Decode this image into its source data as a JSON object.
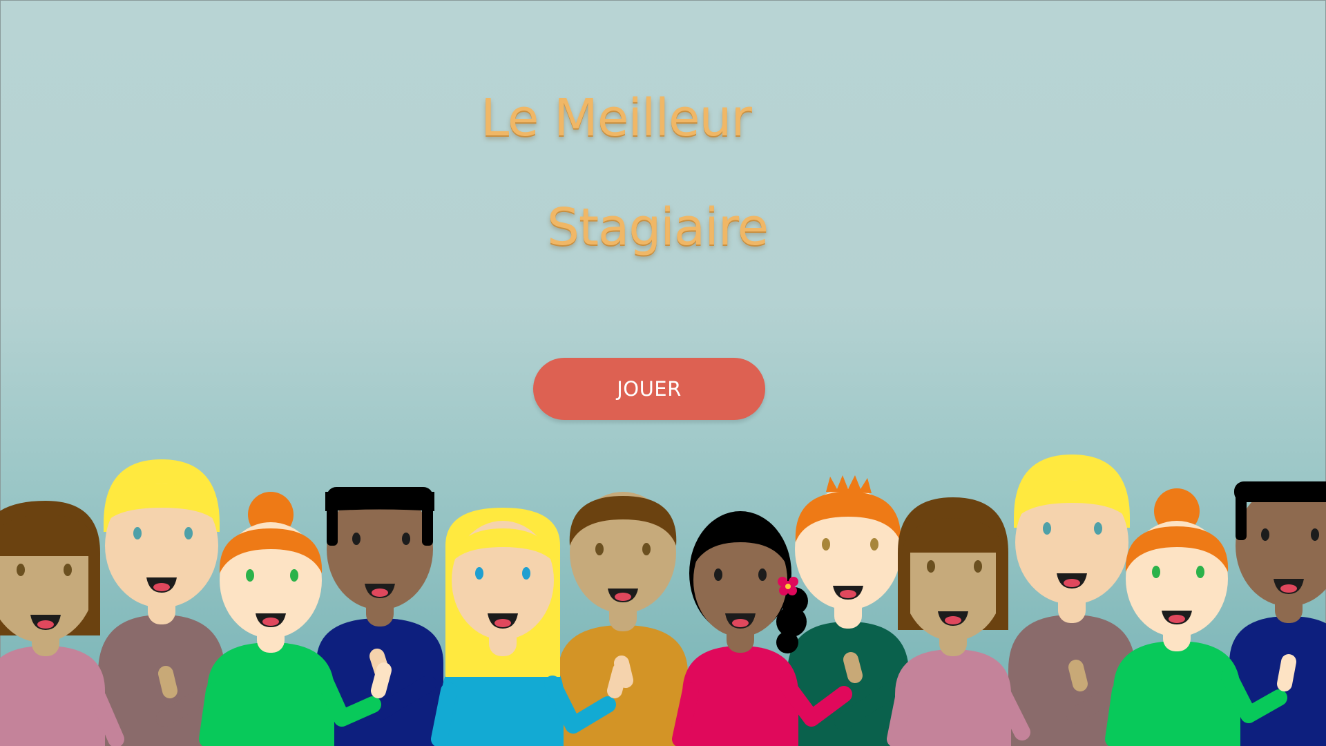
{
  "title": {
    "line1": "Le Meilleur",
    "line2": "Stagiaire"
  },
  "play_button": {
    "label": "JOUER"
  },
  "colors": {
    "title": "#f0b766",
    "button": "#dd6152",
    "button_text": "#ffffff"
  },
  "illustration": {
    "name": "crowd-of-cartoon-people-icon"
  }
}
